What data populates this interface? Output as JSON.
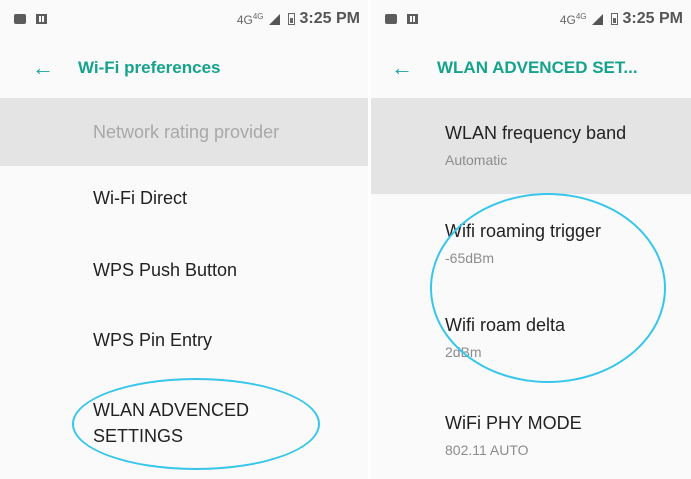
{
  "left": {
    "status": {
      "network": "4G",
      "network_sup": "4G",
      "time": "3:25 PM"
    },
    "toolbar": {
      "title": "Wi-Fi preferences"
    },
    "items": [
      {
        "label": "Network rating provider",
        "disabled": true
      },
      {
        "label": "Wi-Fi Direct"
      },
      {
        "label": "WPS Push Button"
      },
      {
        "label": "WPS Pin Entry"
      },
      {
        "label_line1": "WLAN ADVENCED",
        "label_line2": "SETTINGS"
      }
    ]
  },
  "right": {
    "status": {
      "network": "4G",
      "network_sup": "4G",
      "time": "3:25 PM"
    },
    "toolbar": {
      "title": "WLAN ADVENCED SET..."
    },
    "items": [
      {
        "label": "WLAN frequency band",
        "summary": "Automatic"
      },
      {
        "label": "Wifi roaming trigger",
        "summary": "-65dBm"
      },
      {
        "label": "Wifi roam delta",
        "summary": "2dBm"
      },
      {
        "label": "WiFi PHY MODE",
        "summary": "802.11 AUTO"
      }
    ]
  },
  "colors": {
    "accent": "#16a38e",
    "annotation": "#36c6ea",
    "highlight_row": "#e4e4e4"
  }
}
